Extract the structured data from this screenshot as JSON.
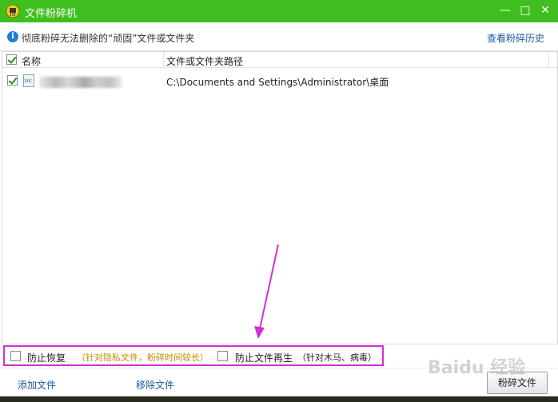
{
  "window": {
    "title": "文件粉碎机",
    "icon": "yellow-shredder-app-icon",
    "buttons": [
      "minimize-icon",
      "maximize-icon",
      "close-icon"
    ]
  },
  "infobar": {
    "icon": "info-icon",
    "text": "彻底粉碎无法删除的“顽固”文件或文件夹",
    "history_link": "查看粉碎历史"
  },
  "table": {
    "columns": [
      "名称",
      "文件或文件夹路径"
    ],
    "rows": [
      {
        "checked": true,
        "icon": "document-file-icon",
        "icon_text": "DOC",
        "name_blurred": true,
        "path": "C:\\Documents and Settings\\Administrator\\桌面"
      }
    ]
  },
  "options": [
    {
      "label": "防止恢复",
      "note": "（针对隐私文件，粉碎时间较长）",
      "checked": false
    },
    {
      "label": "防止文件再生",
      "note": "（针对木马、病毒）",
      "checked": false
    }
  ],
  "bottom": {
    "add_label": "添加文件",
    "remove_label": "移除文件",
    "shred_label": "粉碎文件"
  },
  "watermark": "Baidu 经验",
  "colors": {
    "titlebar": "#3fbf1f",
    "highlight_box": "#d42fd4",
    "note_text": "#c08a00",
    "link": "#1a5aa0"
  }
}
